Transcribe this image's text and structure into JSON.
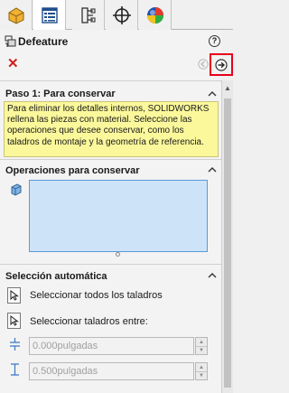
{
  "tabs": [
    {
      "name": "featuremanager-tab",
      "icon": "part-features-icon"
    },
    {
      "name": "propertymanager-tab",
      "icon": "property-list-icon"
    },
    {
      "name": "configurationmanager-tab",
      "icon": "configuration-tree-icon"
    },
    {
      "name": "dimxpert-tab",
      "icon": "crosshair-icon"
    },
    {
      "name": "display-tab",
      "icon": "appearance-sphere-icon"
    }
  ],
  "header": {
    "title": "Defeature",
    "help_glyph": "?",
    "close_glyph": "✕"
  },
  "step1": {
    "title": "Paso 1: Para conservar",
    "message": "Para eliminar los detalles internos, SOLIDWORKS rellena las piezas con material. Seleccione las operaciones que desee conservar, como los taladros de montaje y la geometría de referencia."
  },
  "keep": {
    "title": "Operaciones para conservar"
  },
  "auto": {
    "title": "Selección automática",
    "select_all_holes": "Seleccionar todos los taladros",
    "select_holes_between": "Seleccionar taladros entre:",
    "min_value": "0.000pulgadas",
    "max_value": "0.500pulgadas"
  },
  "colors": {
    "note_bg": "#fbf89c",
    "listbox_bg": "#cde3f7",
    "close_red": "#d01e1e",
    "highlight_red": "#e8001c"
  }
}
